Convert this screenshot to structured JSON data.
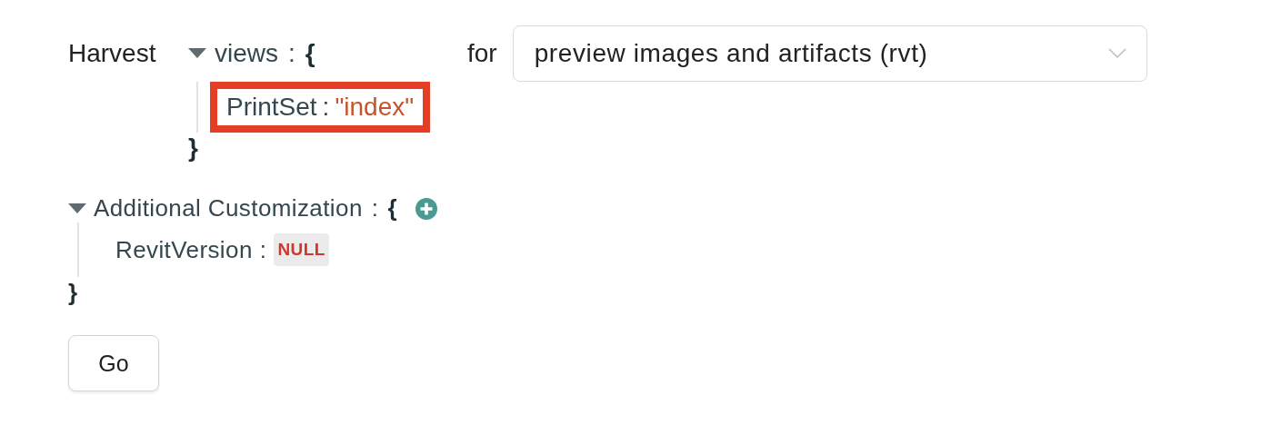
{
  "harvest_label": "Harvest",
  "views": {
    "expanded": true,
    "key": "views",
    "separator": ":",
    "open": "{",
    "close": "}",
    "addable": false,
    "entries": [
      {
        "key": "PrintSet",
        "separator": ":",
        "value": "\"index\"",
        "kind": "string",
        "highlighted": true
      }
    ]
  },
  "for_label": "for",
  "target_select": {
    "value": "preview images and artifacts (rvt)"
  },
  "customization": {
    "expanded": true,
    "key": "Additional Customization",
    "separator": ":",
    "open": "{",
    "close": "}",
    "addable": true,
    "entries": [
      {
        "key": "RevitVersion",
        "separator": ":",
        "value": "NULL",
        "kind": "null",
        "highlighted": false
      }
    ]
  },
  "go_button": "Go"
}
